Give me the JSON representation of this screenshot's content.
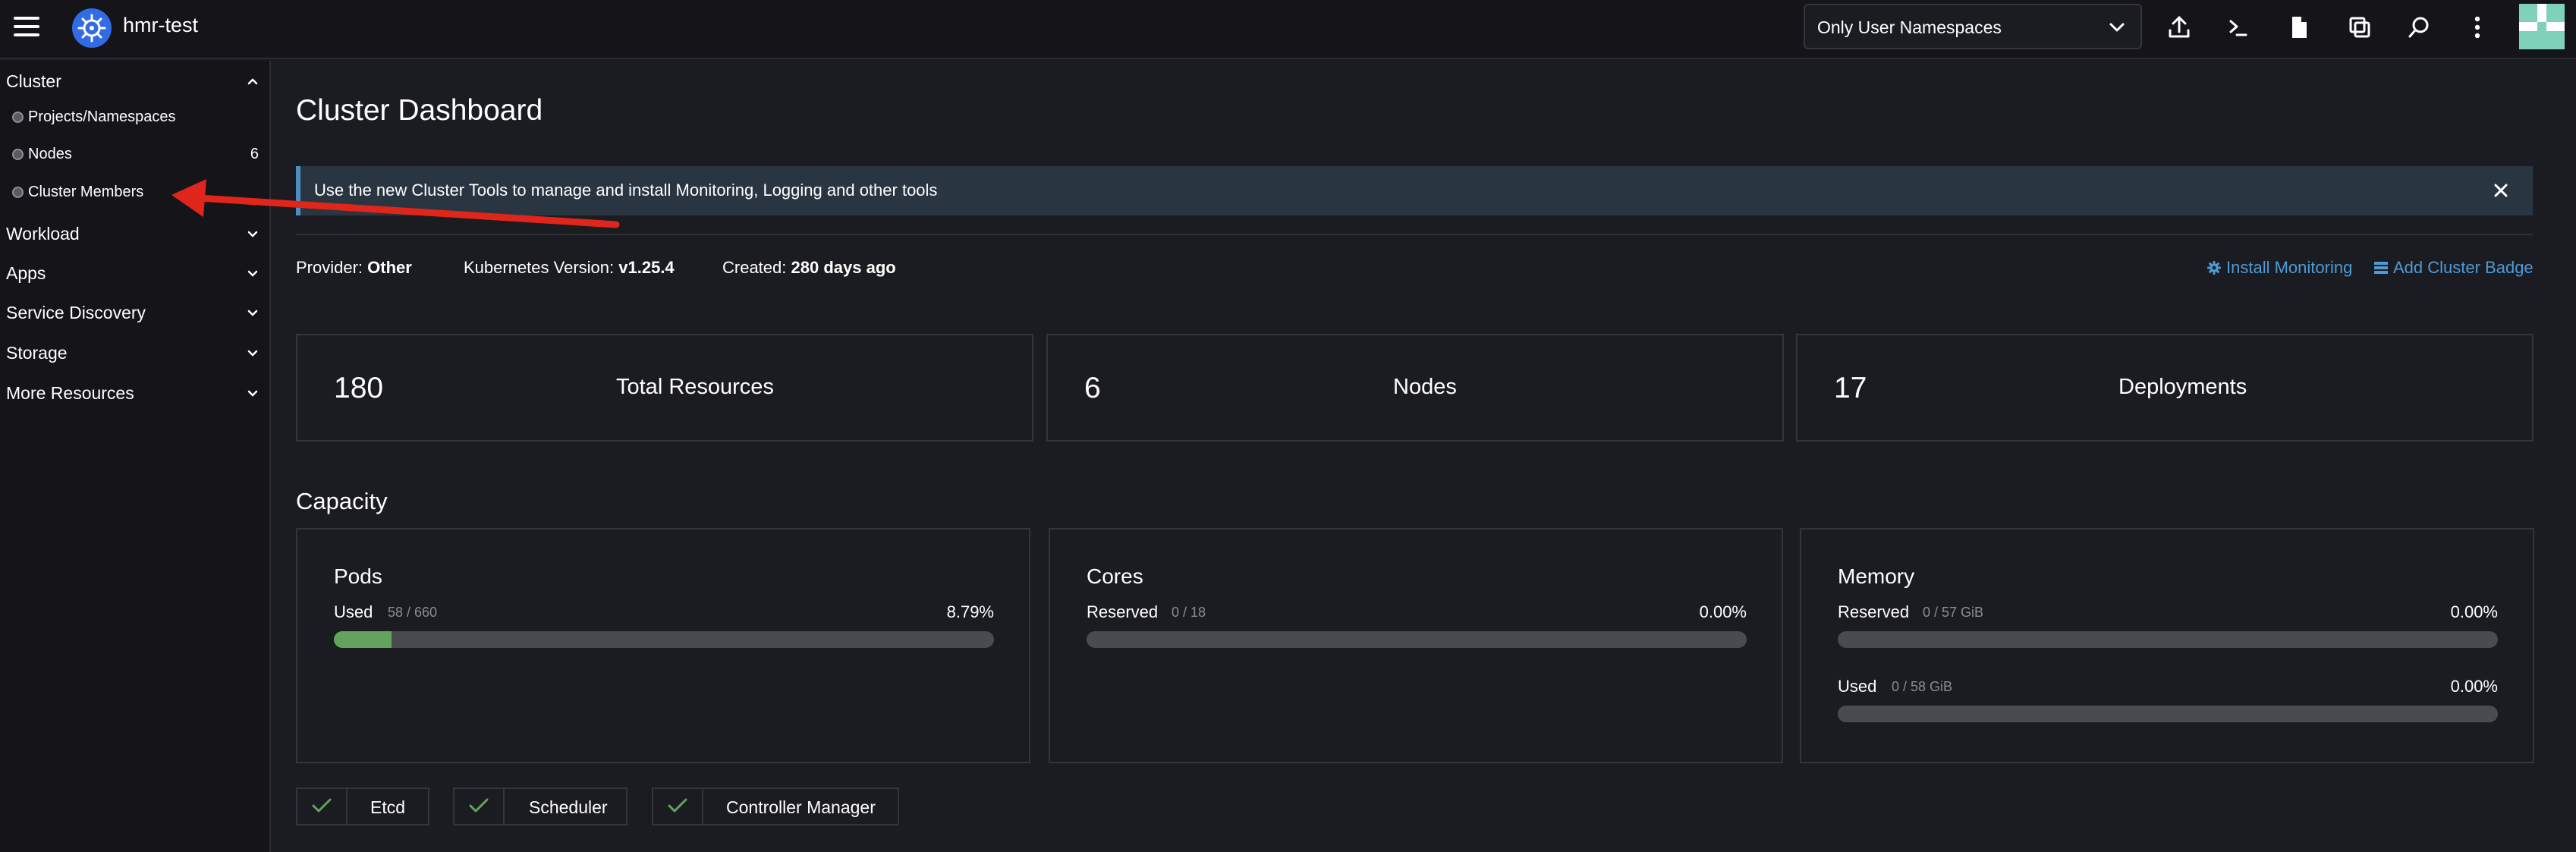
{
  "header": {
    "cluster_name": "hmr-test",
    "namespace_filter": "Only User Namespaces",
    "icons": [
      "menu-icon",
      "kubernetes-logo",
      "upload-icon",
      "terminal-icon",
      "file-icon",
      "copy-icon",
      "search-icon",
      "more-vertical-icon",
      "user-avatar"
    ]
  },
  "sidebar": {
    "groups": [
      {
        "label": "Cluster",
        "expanded": true
      },
      {
        "label": "Workload",
        "expanded": false
      },
      {
        "label": "Apps",
        "expanded": false
      },
      {
        "label": "Service Discovery",
        "expanded": false
      },
      {
        "label": "Storage",
        "expanded": false
      },
      {
        "label": "More Resources",
        "expanded": false
      }
    ],
    "cluster_items": [
      {
        "label": "Projects/Namespaces",
        "count": ""
      },
      {
        "label": "Nodes",
        "count": "6"
      },
      {
        "label": "Cluster Members",
        "count": ""
      }
    ]
  },
  "main": {
    "title": "Cluster Dashboard",
    "banner": {
      "text": "Use the new Cluster Tools to manage and install Monitoring, Logging and other tools"
    },
    "info": {
      "provider_label": "Provider:",
      "provider_value": "Other",
      "k8s_label": "Kubernetes Version:",
      "k8s_value": "v1.25.4",
      "created_label": "Created:",
      "created_value": "280 days ago"
    },
    "links": {
      "install_monitoring": "Install Monitoring",
      "add_cluster_badge": "Add Cluster Badge"
    },
    "stats": [
      {
        "value": "180",
        "label": "Total Resources"
      },
      {
        "value": "6",
        "label": "Nodes"
      },
      {
        "value": "17",
        "label": "Deployments"
      }
    ],
    "capacity": {
      "title": "Capacity",
      "cards": [
        {
          "title": "Pods",
          "meters": [
            {
              "label": "Used",
              "value": "58 / 660",
              "percent": "8.79%",
              "fraction": 0.0879
            }
          ]
        },
        {
          "title": "Cores",
          "meters": [
            {
              "label": "Reserved",
              "value": "0 / 18",
              "percent": "0.00%",
              "fraction": 0
            }
          ]
        },
        {
          "title": "Memory",
          "meters": [
            {
              "label": "Reserved",
              "value": "0 / 57 GiB",
              "percent": "0.00%",
              "fraction": 0
            },
            {
              "label": "Used",
              "value": "0 / 58 GiB",
              "percent": "0.00%",
              "fraction": 0
            }
          ]
        }
      ]
    },
    "components": [
      {
        "label": "Etcd",
        "status": "healthy"
      },
      {
        "label": "Scheduler",
        "status": "healthy"
      },
      {
        "label": "Controller Manager",
        "status": "healthy"
      }
    ]
  },
  "colors": {
    "background": "#1b1c21",
    "sidebar": "#141419",
    "accent_link": "#4e9bd6",
    "banner_bg": "#2a3542",
    "banner_border": "#4e8dc1",
    "meter_fill": "#62a45b",
    "success_check": "#62a45b",
    "annotation_arrow": "#e0251b"
  }
}
